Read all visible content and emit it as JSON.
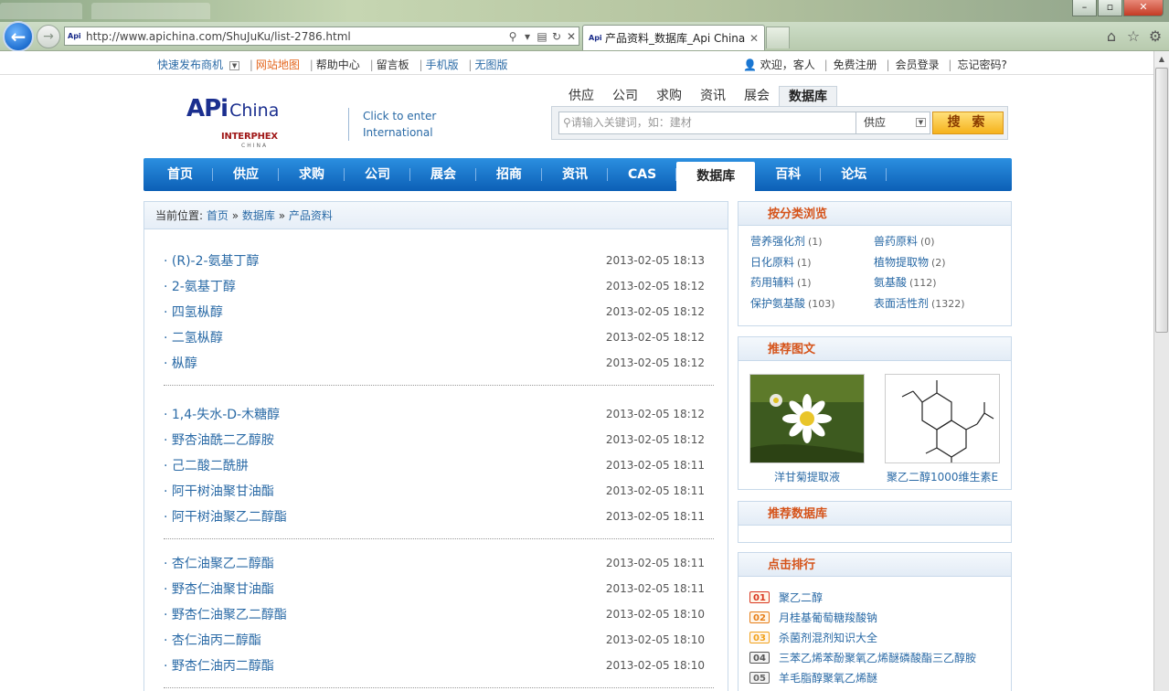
{
  "browser": {
    "url": "http://www.apichina.com/ShuJuKu/list-2786.html",
    "tab_title": "产品资料_数据库_Api China",
    "tab_favicon": "Api"
  },
  "topbar": {
    "left": [
      "快速发布商机",
      "网站地图",
      "帮助中心",
      "留言板",
      "手机版",
      "无图版"
    ],
    "welcome": "欢迎，客人",
    "right": [
      "免费注册",
      "会员登录",
      "忘记密码?"
    ]
  },
  "logo": {
    "api": "APi",
    "china": "China",
    "interphex": "INTERPHEX",
    "cn": "CHINA"
  },
  "intl": {
    "line1": "Click to enter",
    "line2": "International"
  },
  "search": {
    "tabs": [
      "供应",
      "公司",
      "求购",
      "资讯",
      "展会",
      "数据库"
    ],
    "placeholder": "请输入关键词，如：建材",
    "select": "供应",
    "button": "搜 索"
  },
  "nav": [
    "首页",
    "供应",
    "求购",
    "公司",
    "展会",
    "招商",
    "资讯",
    "CAS",
    "数据库",
    "百科",
    "论坛"
  ],
  "breadcrumb": {
    "prefix": "当前位置:",
    "items": [
      "首页",
      "数据库",
      "产品资料"
    ],
    "sep": "»"
  },
  "list": {
    "groups": [
      [
        {
          "name": "· (R)-2-氨基丁醇",
          "date": "2013-02-05 18:13"
        },
        {
          "name": "· 2-氨基丁醇",
          "date": "2013-02-05 18:12"
        },
        {
          "name": "· 四氢枞醇",
          "date": "2013-02-05 18:12"
        },
        {
          "name": "· 二氢枞醇",
          "date": "2013-02-05 18:12"
        },
        {
          "name": "· 枞醇",
          "date": "2013-02-05 18:12"
        }
      ],
      [
        {
          "name": "· 1,4-失水-D-木糖醇",
          "date": "2013-02-05 18:12"
        },
        {
          "name": "· 野杏油酰二乙醇胺",
          "date": "2013-02-05 18:12"
        },
        {
          "name": "· 己二酸二酰肼",
          "date": "2013-02-05 18:11"
        },
        {
          "name": "· 阿干树油聚甘油酯",
          "date": "2013-02-05 18:11"
        },
        {
          "name": "· 阿干树油聚乙二醇酯",
          "date": "2013-02-05 18:11"
        }
      ],
      [
        {
          "name": "· 杏仁油聚乙二醇酯",
          "date": "2013-02-05 18:11"
        },
        {
          "name": "· 野杏仁油聚甘油酯",
          "date": "2013-02-05 18:11"
        },
        {
          "name": "· 野杏仁油聚乙二醇酯",
          "date": "2013-02-05 18:10"
        },
        {
          "name": "· 杏仁油丙二醇酯",
          "date": "2013-02-05 18:10"
        },
        {
          "name": "· 野杏仁油丙二醇酯",
          "date": "2013-02-05 18:10"
        }
      ]
    ]
  },
  "sidebar": {
    "categories": {
      "title": "按分类浏览",
      "items": [
        {
          "name": "营养强化剂",
          "count": "(1)"
        },
        {
          "name": "兽药原料",
          "count": "(0)"
        },
        {
          "name": "日化原料",
          "count": "(1)"
        },
        {
          "name": "植物提取物",
          "count": "(2)"
        },
        {
          "name": "药用辅料",
          "count": "(1)"
        },
        {
          "name": "氨基酸",
          "count": "(112)"
        },
        {
          "name": "保护氨基酸",
          "count": "(103)"
        },
        {
          "name": "表面活性剂",
          "count": "(1322)"
        }
      ]
    },
    "pictures": {
      "title": "推荐图文",
      "items": [
        {
          "caption": "洋甘菊提取液",
          "icon": "chamomile-photo"
        },
        {
          "caption": "聚乙二醇1000维生素E",
          "icon": "chemical-structure"
        }
      ]
    },
    "database": {
      "title": "推荐数据库"
    },
    "ranking": {
      "title": "点击排行",
      "items": [
        {
          "num": "01",
          "name": "聚乙二醇"
        },
        {
          "num": "02",
          "name": "月桂基葡萄糖羧酸钠"
        },
        {
          "num": "03",
          "name": "杀菌剂混剂知识大全"
        },
        {
          "num": "04",
          "name": "三苯乙烯苯酚聚氧乙烯醚磷酸酯三乙醇胺"
        },
        {
          "num": "05",
          "name": "羊毛脂醇聚氧乙烯醚"
        }
      ],
      "colors": [
        "#d9371f",
        "#e67f1a",
        "#f1a21d",
        "#555555",
        "#666666"
      ]
    }
  }
}
